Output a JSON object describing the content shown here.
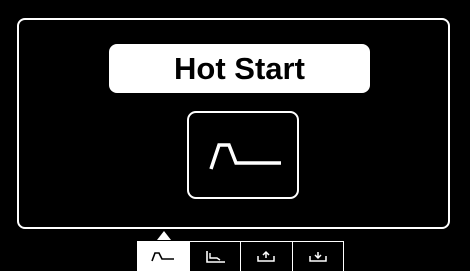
{
  "screen": {
    "title": "Hot Start",
    "mode_icon": "hot-start-waveform-icon"
  },
  "tab_bar": {
    "selected_index": 0,
    "tabs": [
      {
        "icon": "hot-start-waveform-icon",
        "active": true
      },
      {
        "icon": "arc-force-step-icon",
        "active": false
      },
      {
        "icon": "save-memory-icon",
        "active": false
      },
      {
        "icon": "load-memory-icon",
        "active": false
      }
    ]
  },
  "colors": {
    "background": "#000000",
    "foreground": "#ffffff"
  }
}
